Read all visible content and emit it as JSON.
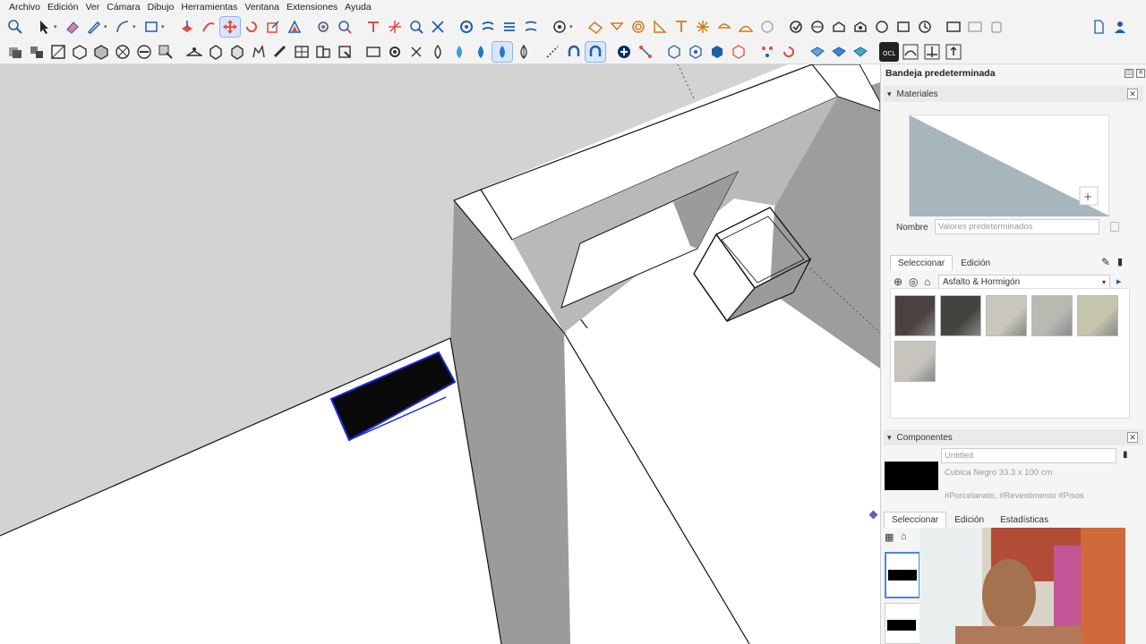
{
  "menu": [
    "Archivo",
    "Edición",
    "Ver",
    "Cámara",
    "Dibujo",
    "Herramientas",
    "Ventana",
    "Extensiones",
    "Ayuda"
  ],
  "toolbar_icons": {
    "row1": [
      "zoom-icon",
      "select-icon",
      "eraser-icon",
      "pencil-icon",
      "arc-icon",
      "rectangle-icon",
      "push-pull-icon",
      "follow-me-icon",
      "move-icon",
      "rotate-icon",
      "scale-icon",
      "offset-icon",
      "tape-measure-icon",
      "protractor-icon",
      "text-icon",
      "axes-icon",
      "dimension-icon",
      "section-plane-icon",
      "paint-bucket-icon",
      "orbit-icon",
      "pan-icon",
      "walk-icon",
      "look-around-icon",
      "sandbox-icon",
      "solid-tools-icon",
      "components-icon",
      "warehouse-icon",
      "layers-icon",
      "styles-icon",
      "scenes-icon",
      "new-file-icon",
      "account-icon"
    ],
    "row2": [
      "views-iso-icon",
      "views-top-icon",
      "views-front-icon",
      "views-right-icon",
      "views-back-icon",
      "views-left-icon",
      "xray-icon",
      "back-edges-icon",
      "wireframe-icon",
      "hidden-line-icon",
      "shaded-icon",
      "textured-icon",
      "monochrome-icon",
      "shadows-icon",
      "fog-icon",
      "section-fill-icon",
      "outliner-icon",
      "materials-icon",
      "snap-icon",
      "add-location-icon",
      "geo-icon",
      "photo-match-icon",
      "soap-bubble-icon",
      "extension-icon"
    ]
  },
  "tray": {
    "title": "Bandeja predeterminada",
    "materials": {
      "header": "Materiales",
      "name_label": "Nombre",
      "name_placeholder": "Valores predeterminados",
      "tabs": [
        "Seleccionar",
        "Edición"
      ],
      "collection": "Asfalto & Hormigón",
      "swatch_colors": [
        "#4a4240",
        "#45433f",
        "#c9c7bc",
        "#b9b9b2",
        "#c5c4ad",
        "#c6c4bd"
      ]
    },
    "components": {
      "header": "Componentes",
      "name_placeholder": "Untitled",
      "description": "Cubica Negro 33.3 x 100 cm",
      "tags": "#Porcelanato, #Revestimento #Pisos",
      "tabs": [
        "Seleccionar",
        "Edición",
        "Estadísticas"
      ]
    }
  },
  "colors": {
    "selection_blue": "#1a2bd8",
    "background_sky": "#d3d3d3",
    "wall_shadow": "#9b9b9b",
    "floor": "#ffffff",
    "accent": "#4a89dc"
  }
}
